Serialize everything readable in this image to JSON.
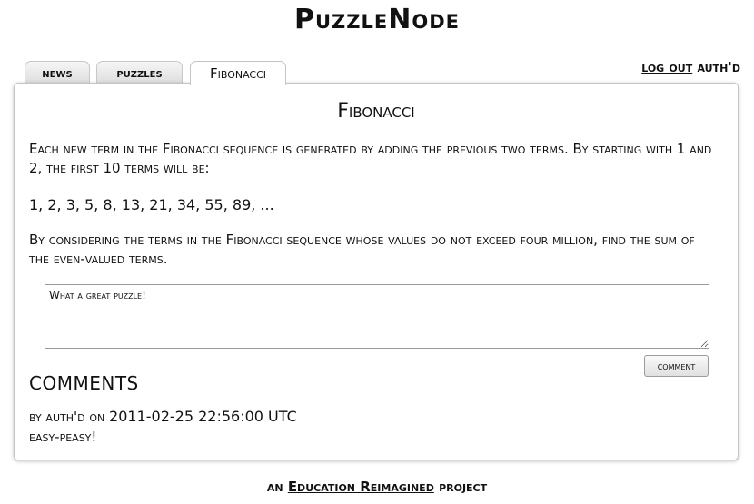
{
  "site": {
    "title": "PuzzleNode"
  },
  "tabs": [
    {
      "label": "news"
    },
    {
      "label": "puzzles"
    },
    {
      "label": "Fibonacci"
    }
  ],
  "userbar": {
    "logout_label": "log out",
    "username": "auth'd"
  },
  "puzzle": {
    "title": "Fibonacci",
    "paragraph_1": "Each new term in the Fibonacci sequence is generated by adding the previous two terms. By starting with 1 and 2, the first 10 terms will be:",
    "sequence": "1, 2, 3, 5, 8, 13, 21, 34, 55, 89, ...",
    "paragraph_2": "By considering the terms in the Fibonacci sequence whose values do not exceed four million, find the sum of the even-valued terms."
  },
  "comment_form": {
    "value": "What a great puzzle!",
    "button_label": "comment"
  },
  "comments": {
    "heading": "COMMENTS",
    "items": [
      {
        "author_prefix": "by auth'd on",
        "timestamp": "2011-02-25 22:56:00 UTC",
        "text": "easy-peasy!"
      }
    ]
  },
  "footer": {
    "prefix": "an",
    "link_label": "Education Reimagined",
    "suffix": "project"
  }
}
